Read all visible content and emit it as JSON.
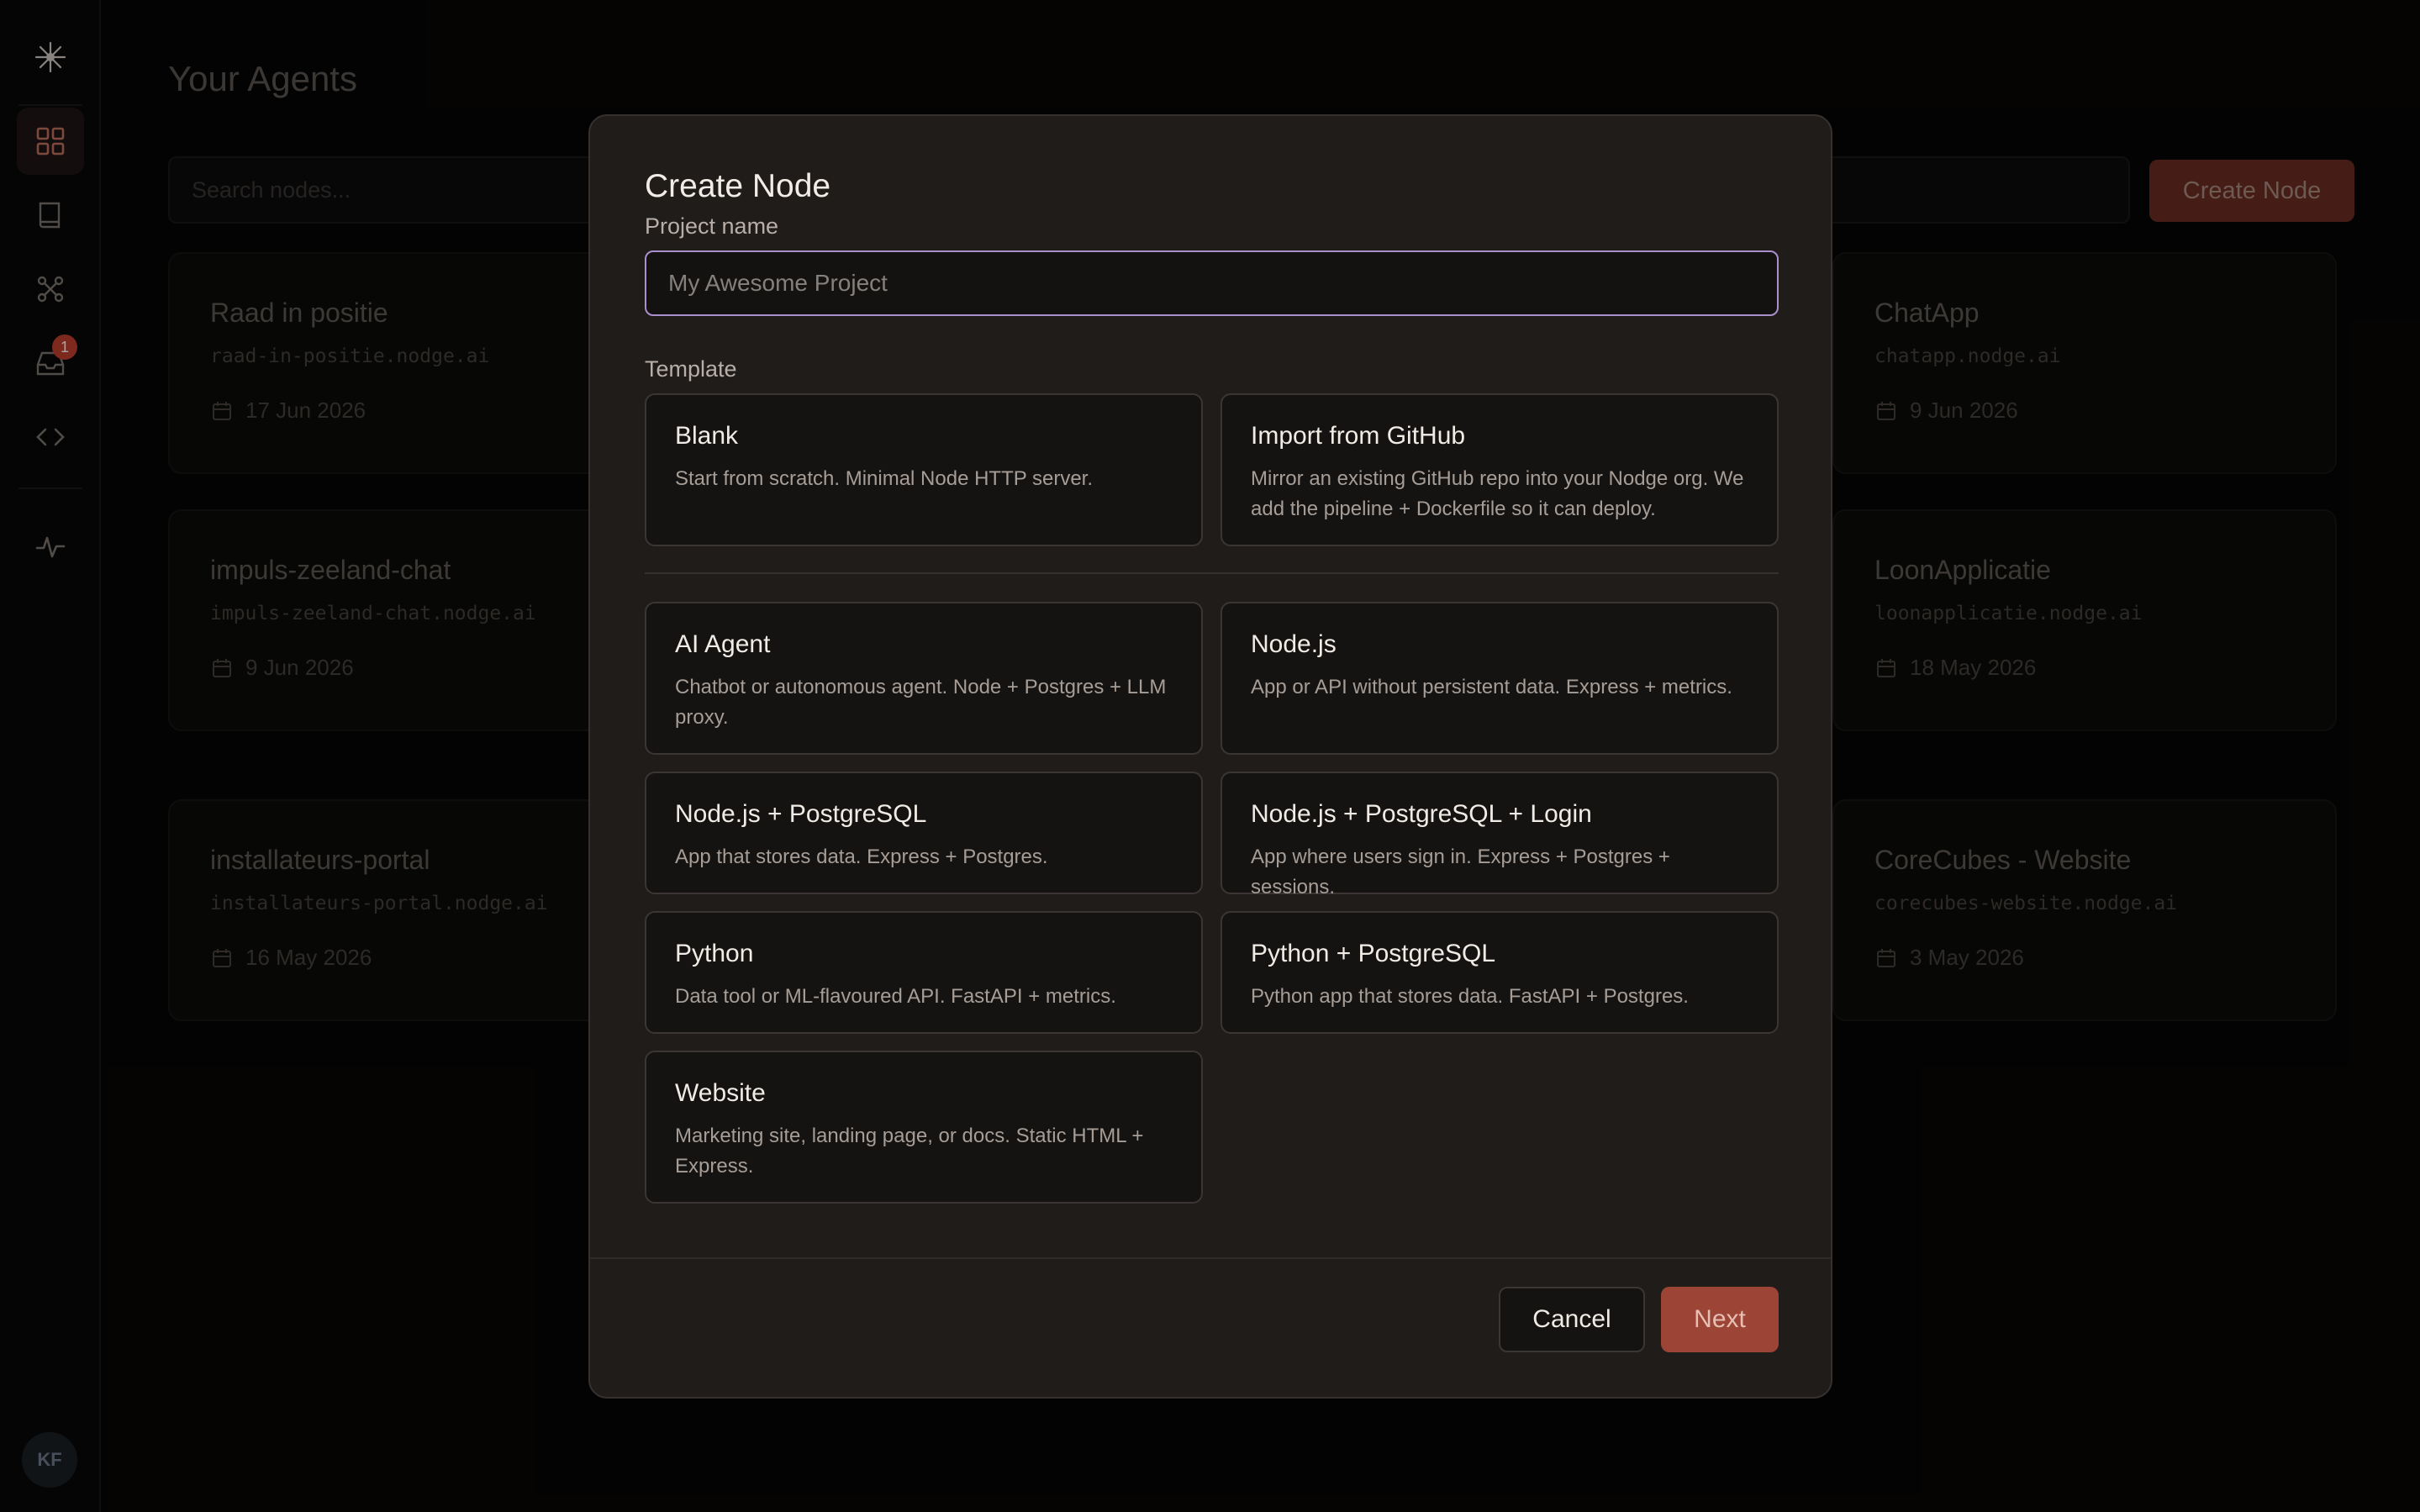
{
  "sidebar": {
    "items": [
      {
        "name": "logo",
        "icon": "sparkle-logo-icon"
      },
      {
        "name": "dashboard",
        "icon": "grid-icon",
        "active": true
      },
      {
        "name": "docs",
        "icon": "book-icon"
      },
      {
        "name": "network",
        "icon": "molecule-icon"
      },
      {
        "name": "inbox",
        "icon": "inbox-icon",
        "badge": "1"
      },
      {
        "name": "code",
        "icon": "code-icon"
      },
      {
        "name": "activity",
        "icon": "activity-icon"
      }
    ],
    "avatar_initials": "KF"
  },
  "page": {
    "title": "Your Agents",
    "search_placeholder": "Search nodes...",
    "create_label": "Create Node"
  },
  "cards": [
    {
      "name": "Raad in positie",
      "url": "raad-in-positie.nodge.ai",
      "date": "17 Jun 2026"
    },
    {
      "name": "ChatApp",
      "url": "chatapp.nodge.ai",
      "date": "9 Jun 2026"
    },
    {
      "name": "impuls-zeeland-chat",
      "url": "impuls-zeeland-chat.nodge.ai",
      "date": "9 Jun 2026"
    },
    {
      "name": "LoonApplicatie",
      "url": "loonapplicatie.nodge.ai",
      "date": "18 May 2026"
    },
    {
      "name": "installateurs-portal",
      "url": "installateurs-portal.nodge.ai",
      "date": "16 May 2026"
    },
    {
      "name": "CoreCubes - Website",
      "url": "corecubes-website.nodge.ai",
      "date": "3 May 2026"
    }
  ],
  "modal": {
    "title": "Create Node",
    "project_label": "Project name",
    "project_placeholder": "My Awesome Project",
    "template_label": "Template",
    "templates": [
      {
        "title": "Blank",
        "desc": "Start from scratch. Minimal Node HTTP server."
      },
      {
        "title": "Import from GitHub",
        "desc": "Mirror an existing GitHub repo into your Nodge org. We add the pipeline + Dockerfile so it can deploy."
      },
      {
        "title": "AI Agent",
        "desc": "Chatbot or autonomous agent. Node + Postgres + LLM proxy."
      },
      {
        "title": "Node.js",
        "desc": "App or API without persistent data. Express + metrics."
      },
      {
        "title": "Node.js + PostgreSQL",
        "desc": "App that stores data. Express + Postgres."
      },
      {
        "title": "Node.js + PostgreSQL + Login",
        "desc": "App where users sign in. Express + Postgres + sessions."
      },
      {
        "title": "Python",
        "desc": "Data tool or ML-flavoured API. FastAPI + metrics."
      },
      {
        "title": "Python + PostgreSQL",
        "desc": "Python app that stores data. FastAPI + Postgres."
      },
      {
        "title": "Website",
        "desc": "Marketing site, landing page, or docs. Static HTML + Express."
      }
    ],
    "cancel_label": "Cancel",
    "next_label": "Next"
  },
  "colors": {
    "accent": "#9c4536",
    "input_focus": "#a98fcc",
    "badge": "#c0402f"
  }
}
